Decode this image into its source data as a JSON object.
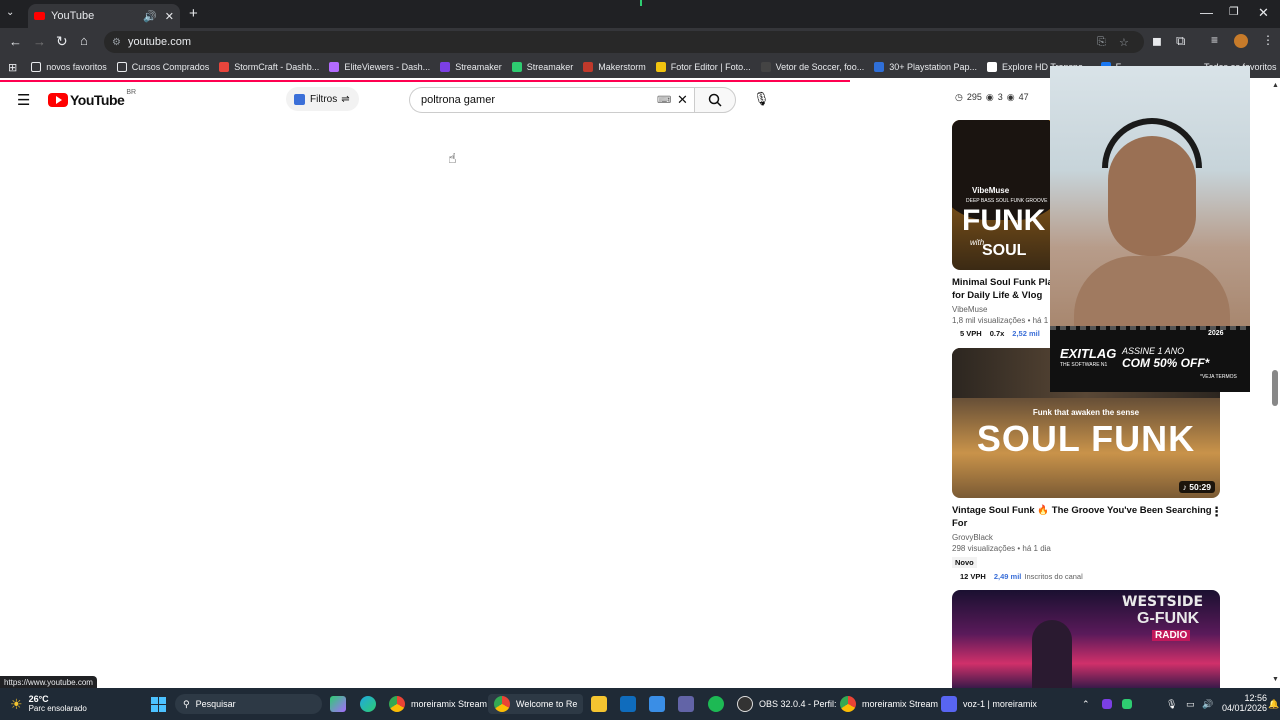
{
  "browser": {
    "tab_title": "YouTube",
    "url": "youtube.com",
    "status_url": "https://www.youtube.com"
  },
  "bookmarks": [
    {
      "label": "novos favoritos",
      "color": "#e8eaed"
    },
    {
      "label": "Cursos Comprados",
      "color": "#e8eaed"
    },
    {
      "label": "StormCraft - Dashb...",
      "color": "#e8453c"
    },
    {
      "label": "EliteViewers - Dash...",
      "color": "#b36bff"
    },
    {
      "label": "Streamaker",
      "color": "#7b3fe4"
    },
    {
      "label": "Streamaker",
      "color": "#2ecc71"
    },
    {
      "label": "Makerstorm",
      "color": "#c0392b"
    },
    {
      "label": "Fotor Editor | Foto...",
      "color": "#f1c40f"
    },
    {
      "label": "Vetor de Soccer, foo...",
      "color": "#444444"
    },
    {
      "label": "30+ Playstation Pap...",
      "color": "#2f6fd8"
    },
    {
      "label": "Explore HD Transpa...",
      "color": "#ffffff"
    },
    {
      "label": "F",
      "color": "#1877f2"
    }
  ],
  "bookmarks_overflow": "Todos os favoritos",
  "youtube": {
    "logo_text": "YouTube",
    "country": "BR",
    "filters_label": "Filtros",
    "search_value": "poltrona gamer"
  },
  "stats": {
    "a": "295",
    "b": "3",
    "c": "47"
  },
  "videos": [
    {
      "title": "Minimal Soul Funk Playlist for Daily Life & Vlog",
      "title_line1": "Minimal Soul Funk Play",
      "title_line2": "for Daily Life & Vlog",
      "channel": "VibeMuse",
      "meta": "1,8 mil visualizações • há 1",
      "vph": "5 VPH",
      "ratio": "0.7x",
      "subs": "2,52 mil",
      "thumb_text_brand": "VibeMuse",
      "thumb_text_sub": "DEEP BASS SOUL FUNK GROOVE",
      "thumb_text_main": "FUNK",
      "thumb_text_with": "with",
      "thumb_text_soul": "SOUL"
    },
    {
      "title_line1": "Vintage Soul Funk 🔥 The Groove You've Been Searching",
      "title_line2": "For",
      "channel": "GrovyBlack",
      "meta": "298 visualizações • há 1 dia",
      "badge": "Novo",
      "vph": "12 VPH",
      "subs": "2,49 mil",
      "subs_suffix": "Inscritos do canal",
      "duration": "50:29",
      "thumb_text_top": "Funk that awaken the sense",
      "thumb_text_main": "SOUL FUNK"
    },
    {
      "thumb_text_1": "WESTSIDE",
      "thumb_text_2": "G-FUNK",
      "thumb_text_3": "RADIO"
    }
  ],
  "ad": {
    "brand": "EXITLAG",
    "tagline": "THE SOFTWARE N1",
    "line1": "ASSINE 1 ANO",
    "line2": "COM 50% OFF*",
    "year": "2026",
    "note": "*VEJA TERMOS"
  },
  "taskbar": {
    "weather_temp": "26°C",
    "weather_desc": "Parc ensolarado",
    "search_placeholder": "Pesquisar",
    "apps": [
      {
        "label": "moreiramix Stream",
        "color": "#e8453c"
      },
      {
        "label": "Welcome to Re",
        "color": "#4285f4"
      },
      {
        "label": "OBS 32.0.4 - Perfil:",
        "color": "#dddddd"
      },
      {
        "label": "moreiramix Stream",
        "color": "#e8453c"
      },
      {
        "label": "voz-1 | moreiramix",
        "color": "#5865f2"
      }
    ],
    "time": "12:56",
    "date": "04/01/2026"
  }
}
